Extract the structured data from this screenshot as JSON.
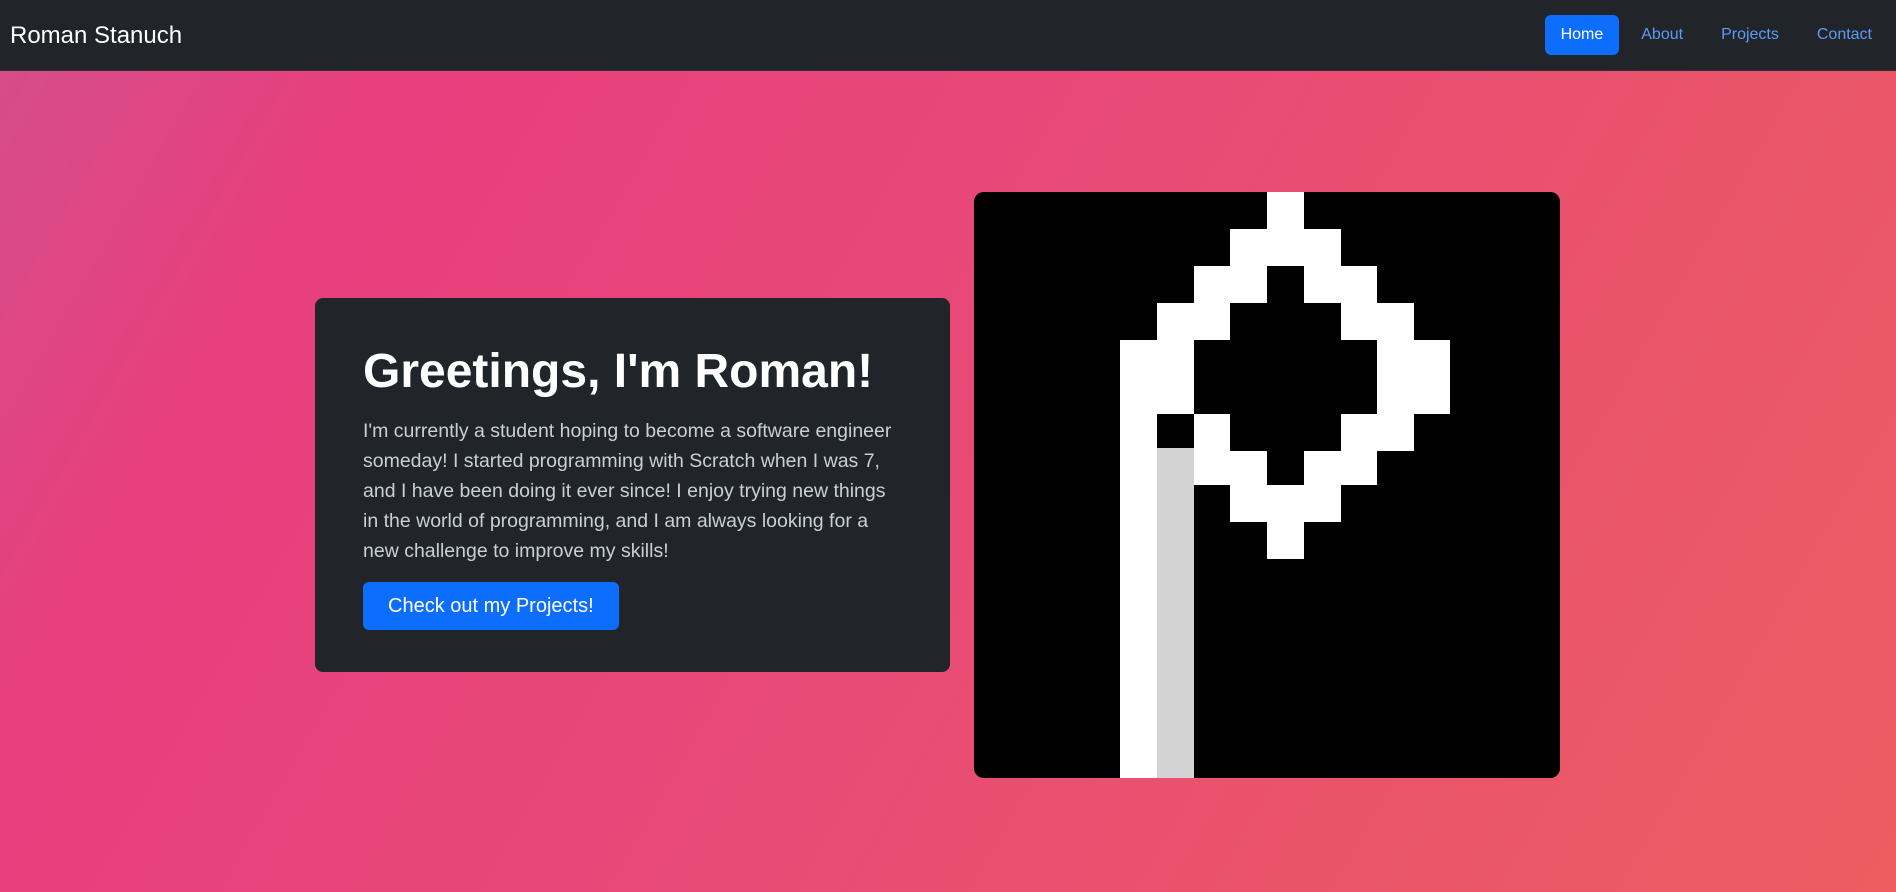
{
  "navbar": {
    "brand": "Roman Stanuch",
    "links": [
      {
        "label": "Home",
        "active": true
      },
      {
        "label": "About",
        "active": false
      },
      {
        "label": "Projects",
        "active": false
      },
      {
        "label": "Contact",
        "active": false
      }
    ]
  },
  "hero": {
    "heading": "Greetings, I'm Roman!",
    "description": "I'm currently a student hoping to become a software engineer someday! I started programming with Scratch when I was 7, and I have been doing it ever since! I enjoy trying new things in the world of programming, and I am always looking for a new challenge to improve my skills!",
    "cta_label": "Check out my Projects!"
  },
  "logo": {
    "icon": "pixel-p-logo-icon",
    "colors": {
      "background": "#000000",
      "primary": "#ffffff",
      "shadow": "#d3d3d3"
    }
  },
  "colors": {
    "accent": "#0d6efd",
    "navbar_bg": "#212529",
    "card_bg": "#212529"
  }
}
